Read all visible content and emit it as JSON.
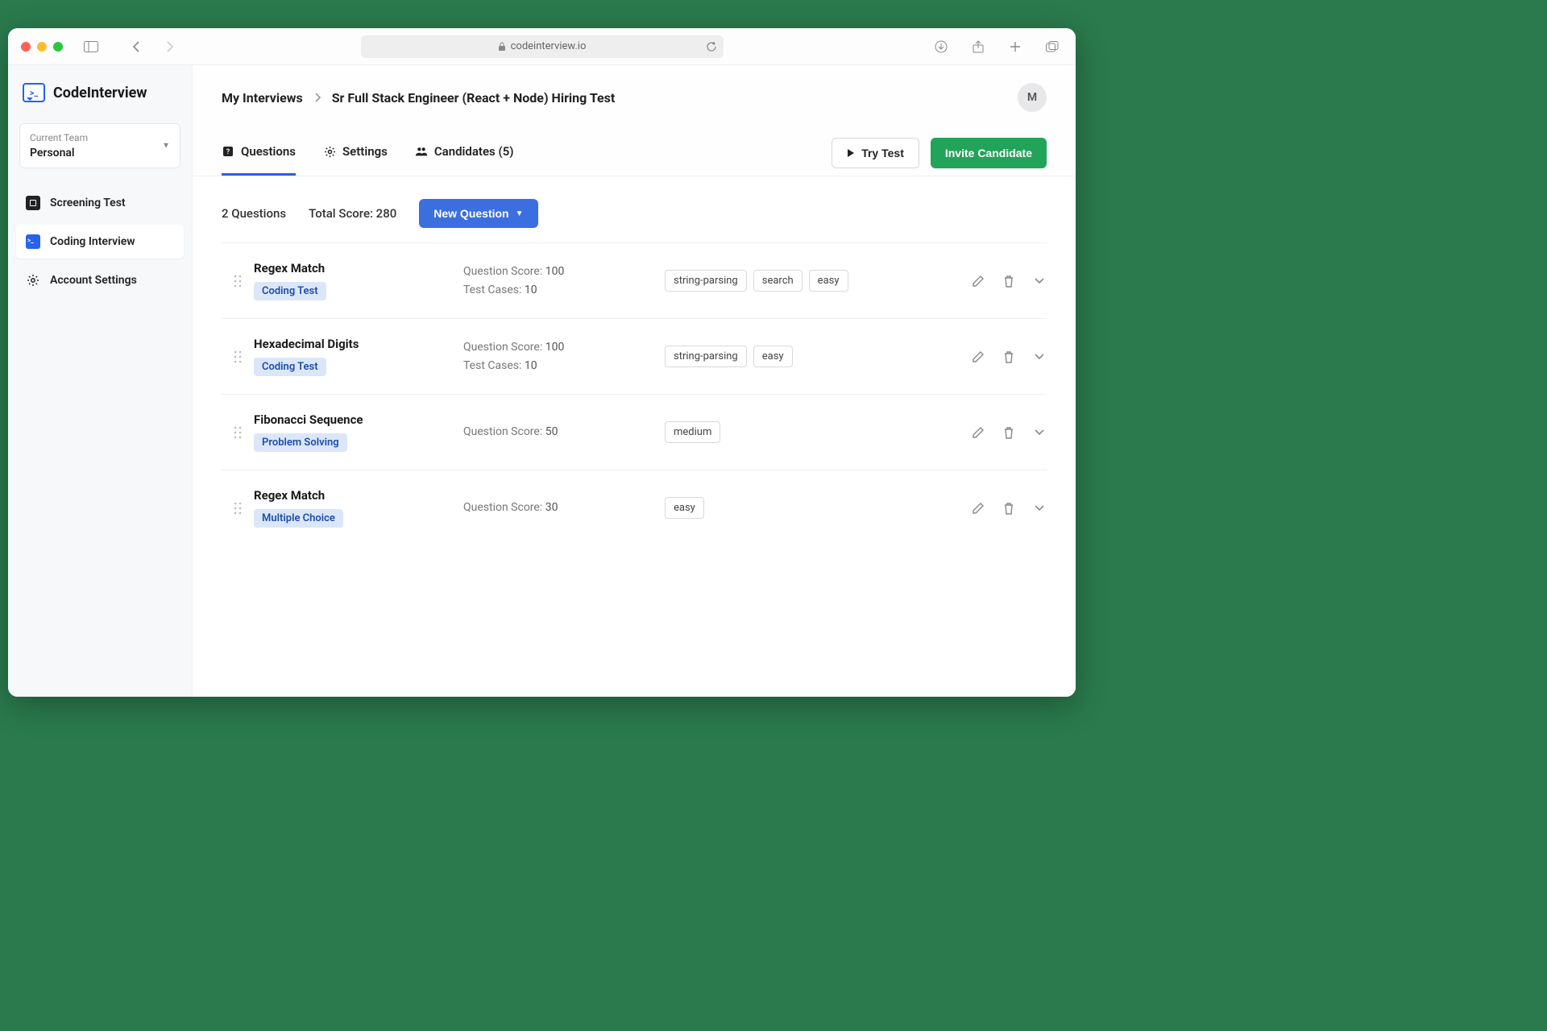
{
  "browser": {
    "url": "codeinterview.io"
  },
  "brand": "CodeInterview",
  "team": {
    "label": "Current Team",
    "value": "Personal"
  },
  "nav": {
    "screening": "Screening Test",
    "coding": "Coding Interview",
    "account": "Account Settings"
  },
  "breadcrumb": {
    "root": "My Interviews",
    "current": "Sr Full Stack Engineer (React + Node) Hiring Test"
  },
  "avatar_initial": "M",
  "tabs": {
    "questions": "Questions",
    "settings": "Settings",
    "candidates": "Candidates (5)"
  },
  "actions": {
    "try_test": "Try Test",
    "invite": "Invite Candidate",
    "new_question": "New Question"
  },
  "summary": {
    "count_text": "2 Questions",
    "score_text": "Total Score: 280"
  },
  "labels": {
    "question_score": "Question Score:",
    "test_cases": "Test Cases:"
  },
  "questions": [
    {
      "title": "Regex Match",
      "type": "Coding Test",
      "score": "100",
      "test_cases": "10",
      "tags": [
        "string-parsing",
        "search",
        "easy"
      ]
    },
    {
      "title": "Hexadecimal Digits",
      "type": "Coding Test",
      "score": "100",
      "test_cases": "10",
      "tags": [
        "string-parsing",
        "easy"
      ]
    },
    {
      "title": "Fibonacci Sequence",
      "type": "Problem Solving",
      "score": "50",
      "test_cases": null,
      "tags": [
        "medium"
      ]
    },
    {
      "title": "Regex Match",
      "type": "Multiple Choice",
      "score": "30",
      "test_cases": null,
      "tags": [
        "easy"
      ]
    }
  ]
}
